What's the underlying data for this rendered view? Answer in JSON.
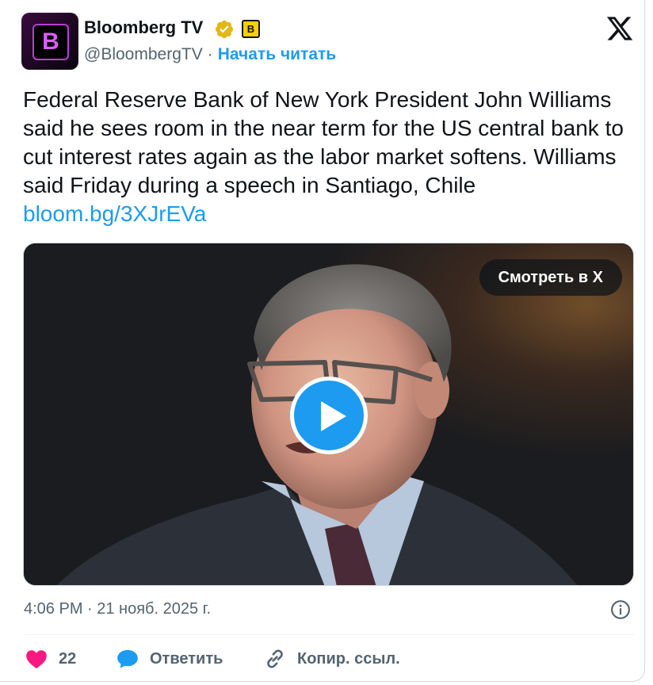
{
  "author": {
    "name": "Bloomberg TV",
    "handle": "@BloombergTV",
    "separator": "·",
    "follow_label": "Начать читать",
    "avatar_letter": "B",
    "affiliate_badge_letter": "B"
  },
  "tweet": {
    "text": "Federal Reserve Bank of New York President John Williams said he sees room in the near term for the US central bank to cut interest rates again as the labor market softens. Williams said Friday during a speech in Santiago, Chile ",
    "link": "bloom.bg/3XJrEVa"
  },
  "media": {
    "watch_label": "Смотреть в X"
  },
  "timestamp": "4:06 PM · 21 нояб. 2025 г.",
  "actions": {
    "like_count": "22",
    "reply_label": "Ответить",
    "copy_link_label": "Копир. ссыл."
  },
  "icons": {
    "verified": "gold-verified-badge-icon",
    "x_logo": "x-logo-icon",
    "info": "info-icon",
    "like": "heart-icon",
    "reply": "speech-bubble-icon",
    "copy": "link-chain-icon",
    "play": "play-icon"
  },
  "colors": {
    "accent": "#1d9bf0",
    "like": "#f91880",
    "text": "#0f1419",
    "secondary": "#536471",
    "verified_gold": "#e2b719"
  }
}
